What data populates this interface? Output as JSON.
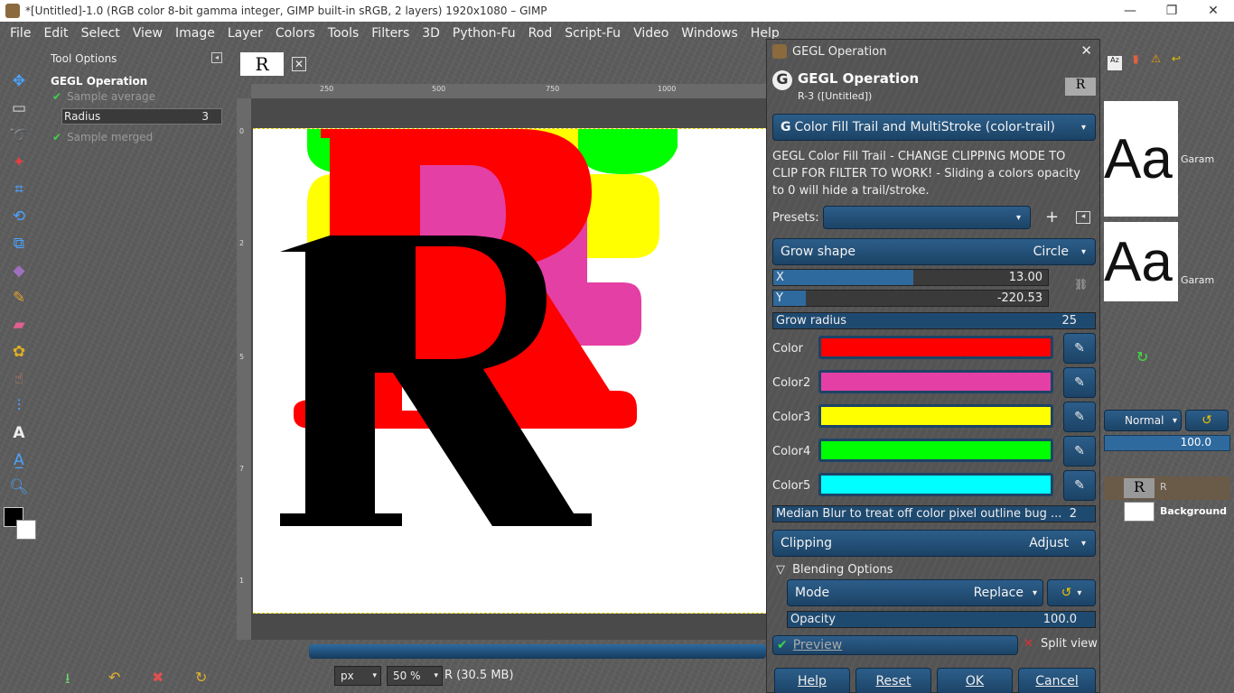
{
  "window": {
    "title": "*[Untitled]-1.0 (RGB color 8-bit gamma integer, GIMP built-in sRGB, 2 layers) 1920x1080 – GIMP",
    "minimize": "—",
    "restore": "❐",
    "close": "✕"
  },
  "menu": [
    "File",
    "Edit",
    "Select",
    "View",
    "Image",
    "Layer",
    "Colors",
    "Tools",
    "Filters",
    "3D",
    "Python-Fu",
    "Rod",
    "Script-Fu",
    "Video",
    "Windows",
    "Help"
  ],
  "tool_options": {
    "header": "Tool Options",
    "operation": "GEGL Operation",
    "sample_average": "Sample average",
    "radius_label": "Radius",
    "radius_value": "3",
    "sample_merged": "Sample merged"
  },
  "image_tab": {
    "thumb": "R",
    "close": "✕"
  },
  "ruler": {
    "h": [
      "250",
      "500",
      "750",
      "1000"
    ],
    "v": [
      "0",
      "2",
      "5",
      "7",
      "1"
    ]
  },
  "status": {
    "unit": "px",
    "zoom": "50 %",
    "info": "R (30.5 MB)"
  },
  "dialog": {
    "title": "GEGL Operation",
    "heading": "GEGL Operation",
    "subheading": "R-3 ([Untitled])",
    "operation": "Color Fill Trail and MultiStroke (color-trail)",
    "description": "GEGL Color Fill Trail - CHANGE CLIPPING MODE TO CLIP FOR FILTER TO WORK! - Sliding a colors opacity to 0 will hide a trail/stroke.",
    "presets_label": "Presets:",
    "grow_shape_label": "Grow shape",
    "grow_shape_value": "Circle",
    "x_label": "X",
    "x_value": "13.00",
    "y_label": "Y",
    "y_value": "-220.53",
    "grow_radius_label": "Grow radius",
    "grow_radius_value": "25",
    "colors": [
      {
        "label": "Color",
        "hex": "#ff0000"
      },
      {
        "label": "Color2",
        "hex": "#e43fa4"
      },
      {
        "label": "Color3",
        "hex": "#ffff00"
      },
      {
        "label": "Color4",
        "hex": "#00ff00"
      },
      {
        "label": "Color5",
        "hex": "#00ffff"
      }
    ],
    "median_label": "Median Blur to treat off color pixel outline bug ...",
    "median_value": "2",
    "clipping_label": "Clipping",
    "clipping_value": "Adjust",
    "blending_label": "Blending Options",
    "mode_label": "Mode",
    "mode_value": "Replace",
    "opacity_label": "Opacity",
    "opacity_value": "100.0",
    "preview_label": "Preview",
    "split_view_label": "Split view",
    "buttons": {
      "help": "Help",
      "reset": "Reset",
      "ok": "OK",
      "cancel": "Cancel"
    }
  },
  "dock": {
    "font_preview": "Aa",
    "font_name_1": "Garam",
    "font_name_2": "Garam",
    "layer_mode": "Normal",
    "layer_opacity": "100.0",
    "layers": [
      {
        "name": "R",
        "thumb": "R"
      },
      {
        "name": "Background",
        "thumb": ""
      }
    ]
  }
}
